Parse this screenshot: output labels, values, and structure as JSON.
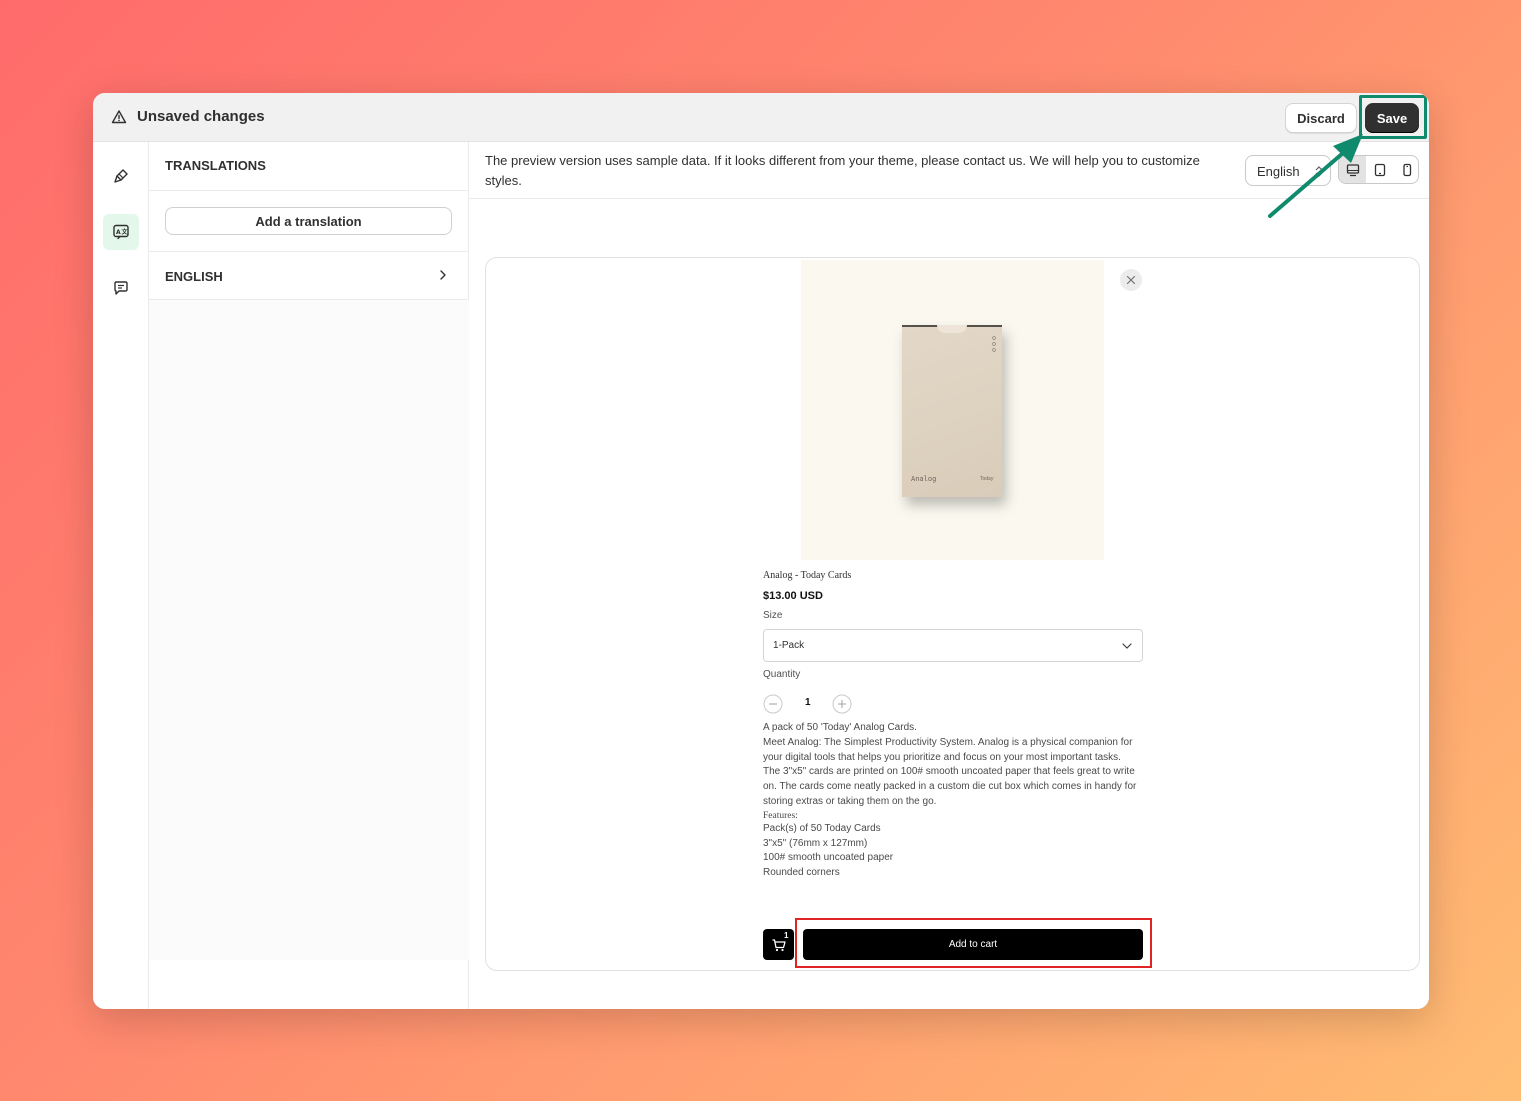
{
  "colors": {
    "accent_annotation": "#0f8a6c",
    "highlight_red": "#e02424",
    "save_button": "#303030",
    "active_rail": "#e3f7ea"
  },
  "topbar": {
    "warning_icon": "warning-triangle-icon",
    "title": "Unsaved changes",
    "discard_label": "Discard",
    "save_label": "Save"
  },
  "rail": {
    "items": [
      {
        "icon": "paintbrush-icon",
        "active": false
      },
      {
        "icon": "translate-icon",
        "active": true
      },
      {
        "icon": "chat-bubble-icon",
        "active": false
      }
    ]
  },
  "panel": {
    "heading": "TRANSLATIONS",
    "add_button_label": "Add a translation",
    "languages": [
      {
        "label": "ENGLISH",
        "icon": "chevron-right-icon"
      }
    ]
  },
  "main": {
    "notice": "The preview version uses sample data. If it looks different from your theme, please contact us. We will help you to customize styles.",
    "language_select_value": "English",
    "device_buttons": [
      {
        "icon": "desktop-icon",
        "active": true
      },
      {
        "icon": "tablet-icon",
        "active": false
      },
      {
        "icon": "mobile-icon",
        "active": false
      }
    ]
  },
  "preview": {
    "image_brand": "Analog",
    "image_subtext": "Today",
    "product_title": "Analog - Today Cards",
    "price": "$13.00 USD",
    "size_label": "Size",
    "size_value": "1-Pack",
    "quantity_label": "Quantity",
    "quantity_value": "1",
    "description": {
      "lines": [
        "A pack of 50 'Today' Analog Cards.",
        "Meet Analog: The Simplest Productivity System. Analog is a physical companion for your digital tools that helps you prioritize and focus on your most important tasks.",
        "The 3\"x5\" cards are printed on 100# smooth uncoated paper that feels great to write on. The cards come neatly packed in a custom die cut box which comes in handy for storing extras or taking them on the go."
      ],
      "features_heading": "Features:",
      "features": [
        "Pack(s) of 50 Today Cards",
        "3\"x5\" (76mm x 127mm)",
        "100# smooth uncoated paper",
        "Rounded corners"
      ]
    },
    "cart_count": "1",
    "add_to_cart_label": "Add to cart"
  }
}
